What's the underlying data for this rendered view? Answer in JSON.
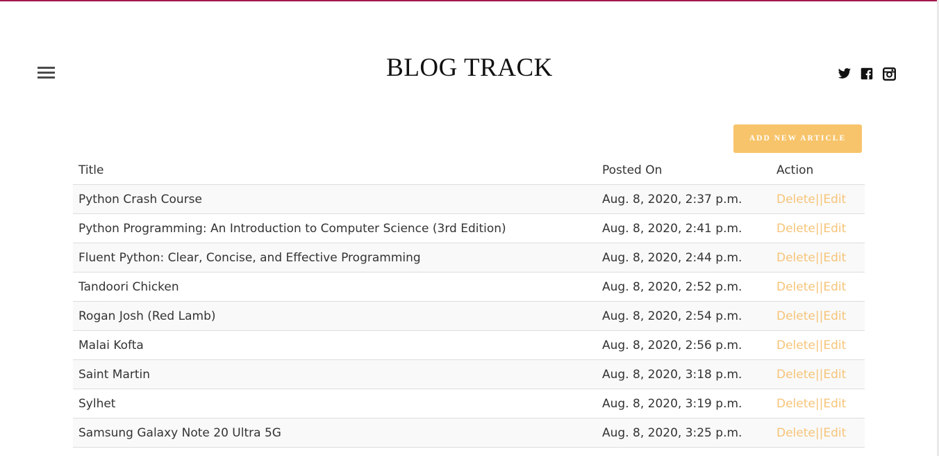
{
  "header": {
    "site_title": "BLOG TRACK",
    "icons": {
      "menu": "hamburger-menu-icon",
      "twitter": "twitter-icon",
      "facebook": "facebook-icon",
      "instagram": "instagram-icon"
    }
  },
  "toolbar": {
    "add_label": "ADD NEW ARTICLE"
  },
  "table": {
    "headers": [
      "Title",
      "Posted On",
      "Action"
    ],
    "rows": [
      {
        "title": "Python Crash Course",
        "posted": "Aug. 8, 2020, 2:37 p.m."
      },
      {
        "title": "Python Programming: An Introduction to Computer Science (3rd Edition)",
        "posted": "Aug. 8, 2020, 2:41 p.m."
      },
      {
        "title": "Fluent Python: Clear, Concise, and Effective Programming",
        "posted": "Aug. 8, 2020, 2:44 p.m."
      },
      {
        "title": "Tandoori Chicken",
        "posted": "Aug. 8, 2020, 2:52 p.m."
      },
      {
        "title": "Rogan Josh (Red Lamb)",
        "posted": "Aug. 8, 2020, 2:54 p.m."
      },
      {
        "title": "Malai Kofta",
        "posted": "Aug. 8, 2020, 2:56 p.m."
      },
      {
        "title": "Saint Martin",
        "posted": "Aug. 8, 2020, 3:18 p.m."
      },
      {
        "title": "Sylhet",
        "posted": "Aug. 8, 2020, 3:19 p.m."
      },
      {
        "title": "Samsung Galaxy Note 20 Ultra 5G",
        "posted": "Aug. 8, 2020, 3:25 p.m."
      }
    ],
    "action_delete": "Delete",
    "action_separator": "||",
    "action_edit": "Edit"
  },
  "colors": {
    "accent_border": "#a3184a",
    "button_bg": "#f7c46b",
    "action_link": "#f6c478"
  }
}
